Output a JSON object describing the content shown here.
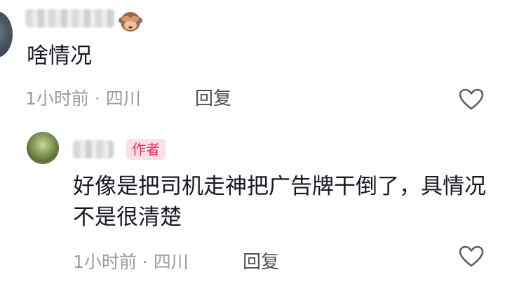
{
  "comments": [
    {
      "author_blurred": true,
      "avatar_icon": "user-avatar",
      "emoji_icon": "see-no-evil-monkey-icon",
      "text": "啥情况",
      "meta": "1小时前 · 四川",
      "reply_label": "回复",
      "like_icon": "heart-outline-icon"
    },
    {
      "author_blurred": true,
      "avatar_icon": "user-avatar",
      "badge": "作者",
      "text": "好像是把司机走神把广告牌干倒了，具情况不是很清楚",
      "meta": "1小时前 · 四川",
      "reply_label": "回复",
      "like_icon": "heart-outline-icon"
    }
  ],
  "colors": {
    "badge_text": "#fe2c55",
    "badge_bg": "#fbe1e5",
    "meta_text": "#9a9ba1",
    "body_text": "#161823"
  }
}
